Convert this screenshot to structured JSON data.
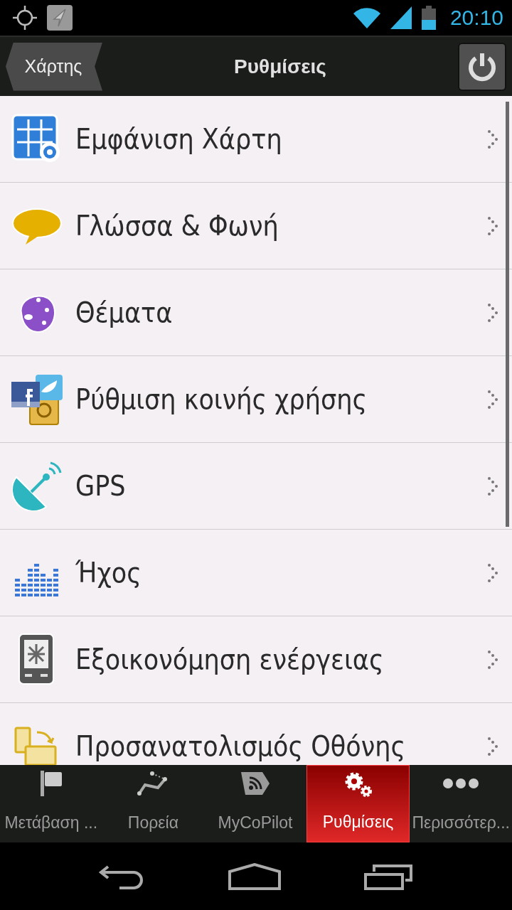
{
  "status_bar": {
    "time": "20:10"
  },
  "header": {
    "back_button": "Χάρτης",
    "title": "Ρυθμίσεις"
  },
  "settings": [
    {
      "label": "Εμφάνιση Χάρτη"
    },
    {
      "label": "Γλώσσα & Φωνή"
    },
    {
      "label": "Θέματα"
    },
    {
      "label": "Ρύθμιση κοινής χρήσης"
    },
    {
      "label": "GPS"
    },
    {
      "label": "Ήχος"
    },
    {
      "label": "Εξοικονόμηση ενέργειας"
    },
    {
      "label": "Προσανατολισμός Οθόνης"
    }
  ],
  "tabs": [
    {
      "label": "Μετάβαση ...",
      "selected": false
    },
    {
      "label": "Πορεία",
      "selected": false
    },
    {
      "label": "MyCoPilot",
      "selected": false
    },
    {
      "label": "Ρυθμίσεις",
      "selected": true
    },
    {
      "label": "Περισσότερ...",
      "selected": false
    }
  ]
}
